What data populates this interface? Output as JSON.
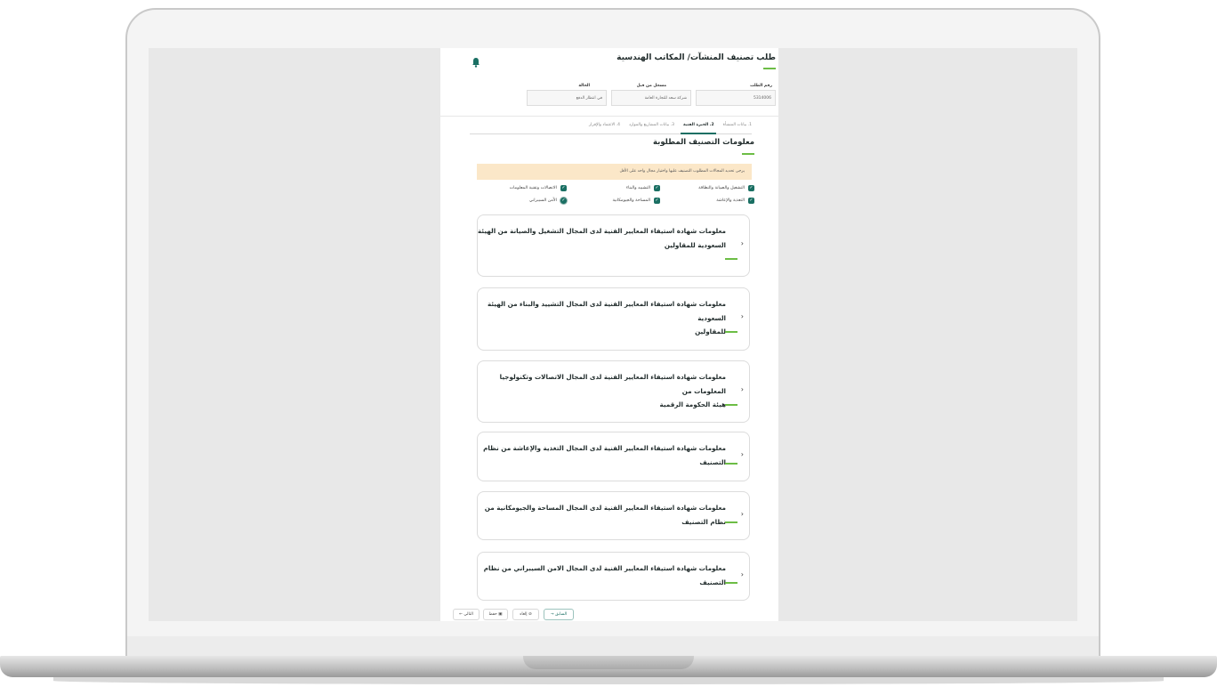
{
  "page": {
    "title": "طلب تصنيف المنشآت/ المكاتب الهندسية",
    "fields": [
      {
        "label": "رقم الطلب",
        "value": "5314006"
      },
      {
        "label": "مسجل من قبل",
        "value": "شركة سعد للتجارة العامة"
      },
      {
        "label": "الحالة",
        "value": "في انتظار الدفع"
      }
    ],
    "steps": [
      {
        "label": "1. بيانات المنشأة",
        "active": false
      },
      {
        "label": "2. الخبرة الفنية",
        "active": true
      },
      {
        "label": "3. بيانات المشاريع والموارد",
        "active": false
      },
      {
        "label": "4. الاعتماد والإقرار",
        "active": false
      }
    ]
  },
  "section": {
    "title": "معلومات التصنيف المطلوبة",
    "notice": "يرجى تحديد المجالات المطلوب التصنيف عليها واختيار مجال واحد على الأقل"
  },
  "checkboxes": [
    {
      "label": "التشغيل والصيانة والنظافة",
      "checked": true
    },
    {
      "label": "التشييد والبناء",
      "checked": true
    },
    {
      "label": "الاتصالات وتقنية المعلومات",
      "checked": true
    },
    {
      "label": "التغذية والإعاشة",
      "checked": true
    },
    {
      "label": "المساحة والجيومكانية",
      "checked": true
    },
    {
      "label": "الأمن السيبراني",
      "checked": true
    }
  ],
  "cards": [
    {
      "line1": "معلومات شهادة استيفاء المعايير الفنية لدى المجال التشغيل والصيانة من الهيئة",
      "line2": "السعودية للمقاولين"
    },
    {
      "line1": "معلومات شهادة استيفاء المعايير الفنية لدى المجال التشييد والبناء من الهيئة السعودية",
      "line2": "للمقاولين"
    },
    {
      "line1": "معلومات شهادة استيفاء المعايير الفنية لدى المجال الاتصالات وتكنولوجيا المعلومات من",
      "line2": "هيئة الحكومة الرقمية"
    },
    {
      "line1": "معلومات شهادة استيفاء المعايير الفنية لدى المجال التغذية والإعاشة من نظام التصنيف",
      "line2": ""
    },
    {
      "line1": "معلومات شهادة استيفاء المعايير الفنية لدى المجال المساحة والجيومكانية من نظام التصنيف",
      "line2": ""
    },
    {
      "line1": "معلومات شهادة استيفاء المعايير الفنية لدى المجال الامن السيبراني من نظام التصنيف",
      "line2": ""
    }
  ],
  "buttons": {
    "back": "السابق",
    "save": "حفظ",
    "cancel": "إلغاء",
    "next": "التالي"
  },
  "colors": {
    "accent_green": "#6cbd45",
    "primary_teal": "#1a6f63",
    "notice_bg": "#fbe7c8"
  },
  "icons": {
    "bell": "bell-icon",
    "check": "check-icon",
    "chevron": "chevron-left-icon"
  }
}
